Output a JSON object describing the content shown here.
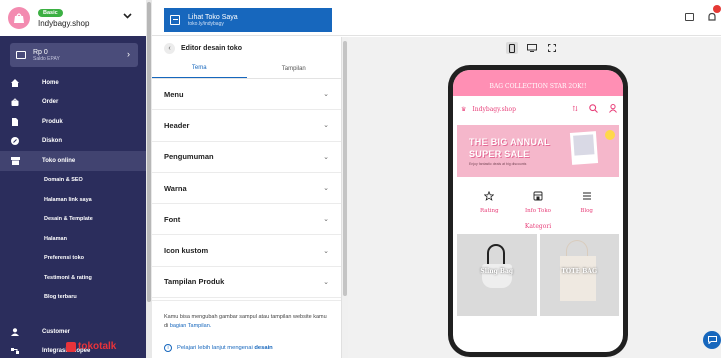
{
  "store": {
    "plan_badge": "Basic",
    "name": "Indybagy.shop"
  },
  "balance": {
    "amount": "Rp 0",
    "label": "Saldo EPAY"
  },
  "sidebar": {
    "items": [
      {
        "label": "Home",
        "icon": "home-icon"
      },
      {
        "label": "Order",
        "icon": "bag-icon"
      },
      {
        "label": "Produk",
        "icon": "product-icon"
      },
      {
        "label": "Diskon",
        "icon": "discount-icon"
      },
      {
        "label": "Toko online",
        "icon": "store-icon",
        "active": true
      }
    ],
    "subitems": [
      "Domain & SEO",
      "Halaman link saya",
      "Desain & Template",
      "Halaman",
      "Preferensi toko",
      "Testimoni & rating",
      "Blog terbaru"
    ],
    "bottom": [
      {
        "label": "Customer",
        "icon": "customer-icon"
      },
      {
        "label": "Integrasi Shopee",
        "icon": "integration-icon"
      }
    ],
    "brand_watermark": "tokotalk"
  },
  "topbar": {
    "view_store_title": "Lihat Toko Saya",
    "view_store_url": "toko.ly/indybagy",
    "notification_color": "#e53935"
  },
  "editor": {
    "title": "Editor desain toko",
    "tabs": [
      "Tema",
      "Tampilan"
    ],
    "active_tab": "Tema",
    "sections": [
      "Menu",
      "Header",
      "Pengumuman",
      "Warna",
      "Font",
      "Icon kustom",
      "Tampilan Produk"
    ],
    "note_prefix": "Kamu bisa mengubah gambar sampul atau tampilan website kamu di",
    "note_link": "bagian Tampilan.",
    "learn_prefix": "Pelajari lebih lanjut mengenai",
    "learn_bold": "desain"
  },
  "preview": {
    "device": "mobile",
    "announcement": "BAG COLLECTION STAR 2OK!!",
    "shop_name": "Indybagy.shop",
    "banner_line1": "THE BIG ANNUAL",
    "banner_line2": "SUPER SALE",
    "banner_small": "Enjoy fantastic deals at big discounts",
    "quick_links": [
      "Rating",
      "Info Toko",
      "Blog"
    ],
    "category_title": "Kategori",
    "categories": [
      "Sling Bag",
      "TOTE BAG"
    ]
  },
  "colors": {
    "sidebar_bg": "#2b2d5c",
    "accent_blue": "#1767bd",
    "shop_pink": "#e8407a",
    "announcement_pink": "#ff8fb4"
  }
}
